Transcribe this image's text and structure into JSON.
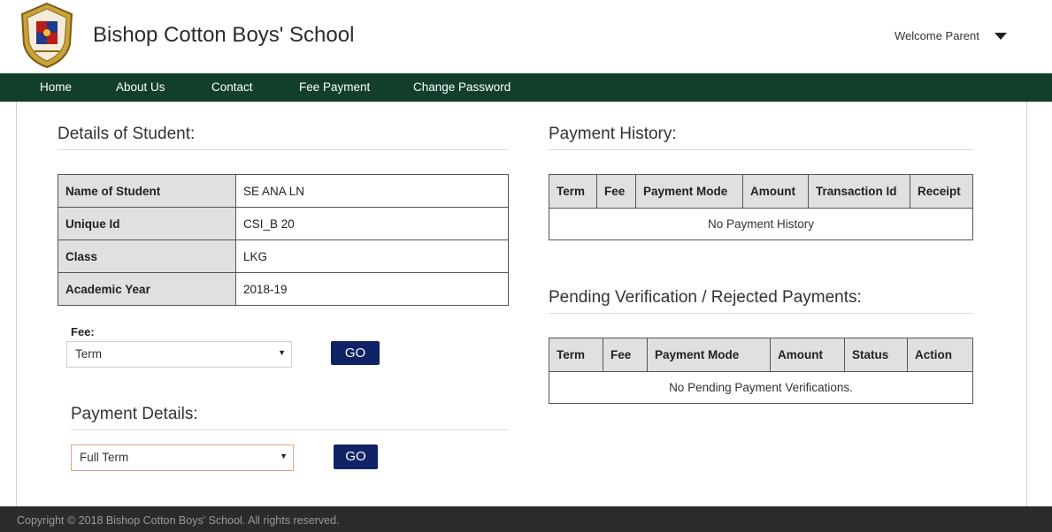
{
  "header": {
    "title": "Bishop Cotton Boys' School",
    "welcome": "Welcome Parent",
    "logo_icon": "school-crest-icon"
  },
  "nav": {
    "items": [
      {
        "label": "Home"
      },
      {
        "label": "About Us"
      },
      {
        "label": "Contact"
      },
      {
        "label": "Fee Payment"
      },
      {
        "label": "Change Password"
      }
    ]
  },
  "student": {
    "title": "Details of Student:",
    "rows": [
      {
        "label": "Name of Student",
        "value": "SE      ANA    LN"
      },
      {
        "label": "Unique Id",
        "value": "CSI_B  20"
      },
      {
        "label": "Class",
        "value": "LKG"
      },
      {
        "label": "Academic Year",
        "value": "2018-19"
      }
    ]
  },
  "fee": {
    "label": "Fee:",
    "selected": "Term",
    "go_label": "GO"
  },
  "payment_details": {
    "title": "Payment Details:",
    "selected": "Full Term",
    "go_label": "GO"
  },
  "history": {
    "title": "Payment History:",
    "headers": [
      "Term",
      "Fee",
      "Payment Mode",
      "Amount",
      "Transaction Id",
      "Receipt"
    ],
    "empty": "No Payment History"
  },
  "pending": {
    "title": "Pending Verification / Rejected Payments:",
    "headers": [
      "Term",
      "Fee",
      "Payment Mode",
      "Amount",
      "Status",
      "Action"
    ],
    "empty": "No Pending Payment Verifications."
  },
  "footer": {
    "copyright": "Copyright © 2018 Bishop Cotton Boys' School. All rights reserved."
  },
  "colors": {
    "nav_bg": "#113f2c",
    "button_bg": "#0f2366",
    "footer_bg": "#2b2b2b"
  }
}
